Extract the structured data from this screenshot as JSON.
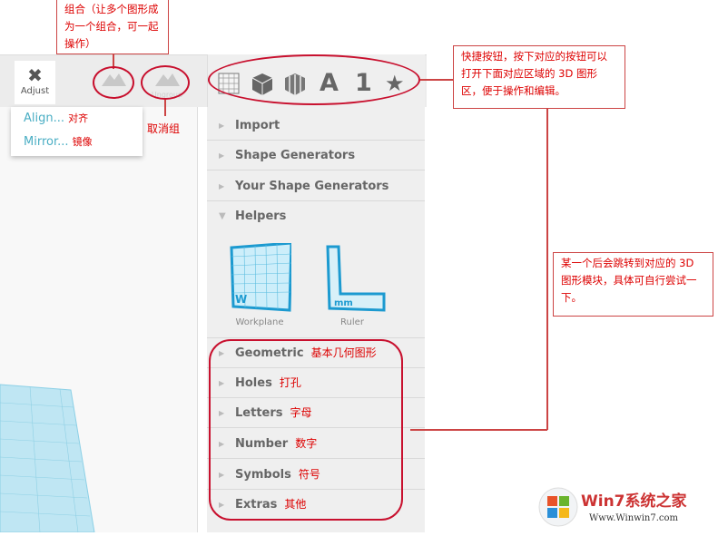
{
  "toolbar": {
    "adjust_label": "Adjust",
    "group_label": "Group",
    "ungroup_label": "Ungroup"
  },
  "adjust_menu": [
    {
      "label": "Align...",
      "note": "对齐"
    },
    {
      "label": "Mirror...",
      "note": "镜像"
    }
  ],
  "quick_buttons": [
    {
      "icon": "workplane-grid-icon"
    },
    {
      "icon": "cube-icon"
    },
    {
      "icon": "striped-cube-icon"
    },
    {
      "icon": "letter-a-icon",
      "label": "A"
    },
    {
      "icon": "number-one-icon",
      "label": "1"
    },
    {
      "icon": "star-icon",
      "label": "★"
    }
  ],
  "panel": {
    "sections_top": [
      "Import",
      "Shape Generators",
      "Your Shape Generators"
    ],
    "helpers": {
      "label": "Helpers",
      "items": [
        "Workplane",
        "Ruler"
      ],
      "workplane_mark": "W",
      "ruler_mark": "mm"
    },
    "categories": [
      {
        "label": "Geometric",
        "note": "基本几何图形"
      },
      {
        "label": "Holes",
        "note": "打孔"
      },
      {
        "label": "Letters",
        "note": "字母"
      },
      {
        "label": "Number",
        "note": "数字"
      },
      {
        "label": "Symbols",
        "note": "符号"
      },
      {
        "label": "Extras",
        "note": "其他"
      }
    ]
  },
  "annotations": {
    "group": "组合（让多个图形成为一个组合，可一起操作）",
    "ungroup": "取消组",
    "quickbar": "快捷按钮，按下对应的按钮可以打开下面对应区域的 3D 图形区，便于操作和编辑。",
    "categories": "某一个后会跳转到对应的 3D 图形模块，具体可自行尝试一下。"
  },
  "watermark": {
    "brand": "Win7系统之家",
    "url": "Www.Winwin7.com"
  },
  "colors": {
    "annotation": "#cc0000",
    "accent": "#4aaec4",
    "panel": "#efefef"
  }
}
